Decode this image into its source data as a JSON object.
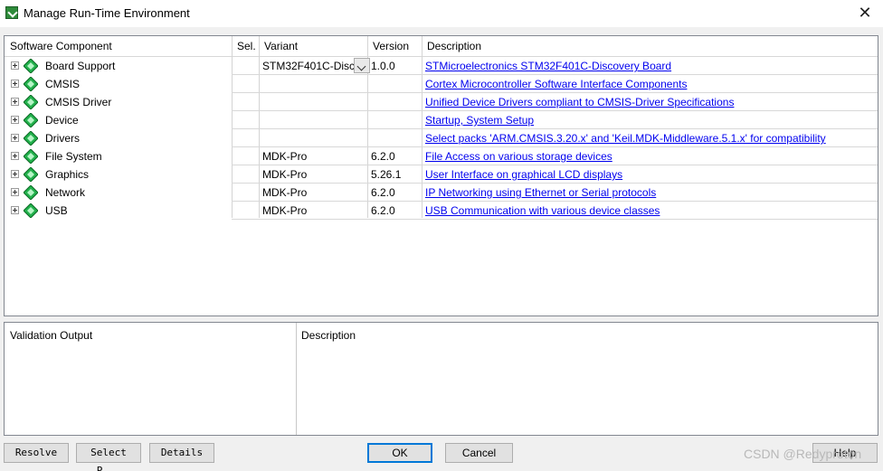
{
  "window": {
    "title": "Manage Run-Time Environment",
    "close_glyph": "✕"
  },
  "tree": {
    "columns": {
      "component": "Software Component",
      "sel": "Sel.",
      "variant": "Variant",
      "version": "Version",
      "description": "Description"
    },
    "rows": [
      {
        "name": "Board Support",
        "variant": "STM32F401C-Discc",
        "version": "1.0.0",
        "description": "STMicroelectronics STM32F401C-Discovery Board",
        "has_dropdown": true
      },
      {
        "name": "CMSIS",
        "variant": "",
        "version": "",
        "description": "Cortex Microcontroller Software Interface Components"
      },
      {
        "name": "CMSIS Driver",
        "variant": "",
        "version": "",
        "description": "Unified Device Drivers compliant to CMSIS-Driver Specifications"
      },
      {
        "name": "Device",
        "variant": "",
        "version": "",
        "description": "Startup, System Setup"
      },
      {
        "name": "Drivers",
        "variant": "",
        "version": "",
        "description": "Select packs 'ARM.CMSIS.3.20.x' and 'Keil.MDK-Middleware.5.1.x' for compatibility"
      },
      {
        "name": "File System",
        "variant": "MDK-Pro",
        "version": "6.2.0",
        "description": "File Access on various storage devices"
      },
      {
        "name": "Graphics",
        "variant": "MDK-Pro",
        "version": "5.26.1",
        "description": "User Interface on graphical LCD displays"
      },
      {
        "name": "Network",
        "variant": "MDK-Pro",
        "version": "6.2.0",
        "description": "IP Networking using Ethernet or Serial protocols"
      },
      {
        "name": "USB",
        "variant": "MDK-Pro",
        "version": "6.2.0",
        "description": "USB Communication with various device classes"
      }
    ]
  },
  "validation": {
    "output_header": "Validation Output",
    "description_header": "Description"
  },
  "buttons": {
    "resolve": "Resolve",
    "select_packs": "Select P...",
    "details": "Details",
    "ok": "OK",
    "cancel": "Cancel",
    "help": "Help"
  },
  "watermark": "CSDN @Redyproton",
  "colors": {
    "link": "#0000ee",
    "component_gem": "#22b14c"
  }
}
